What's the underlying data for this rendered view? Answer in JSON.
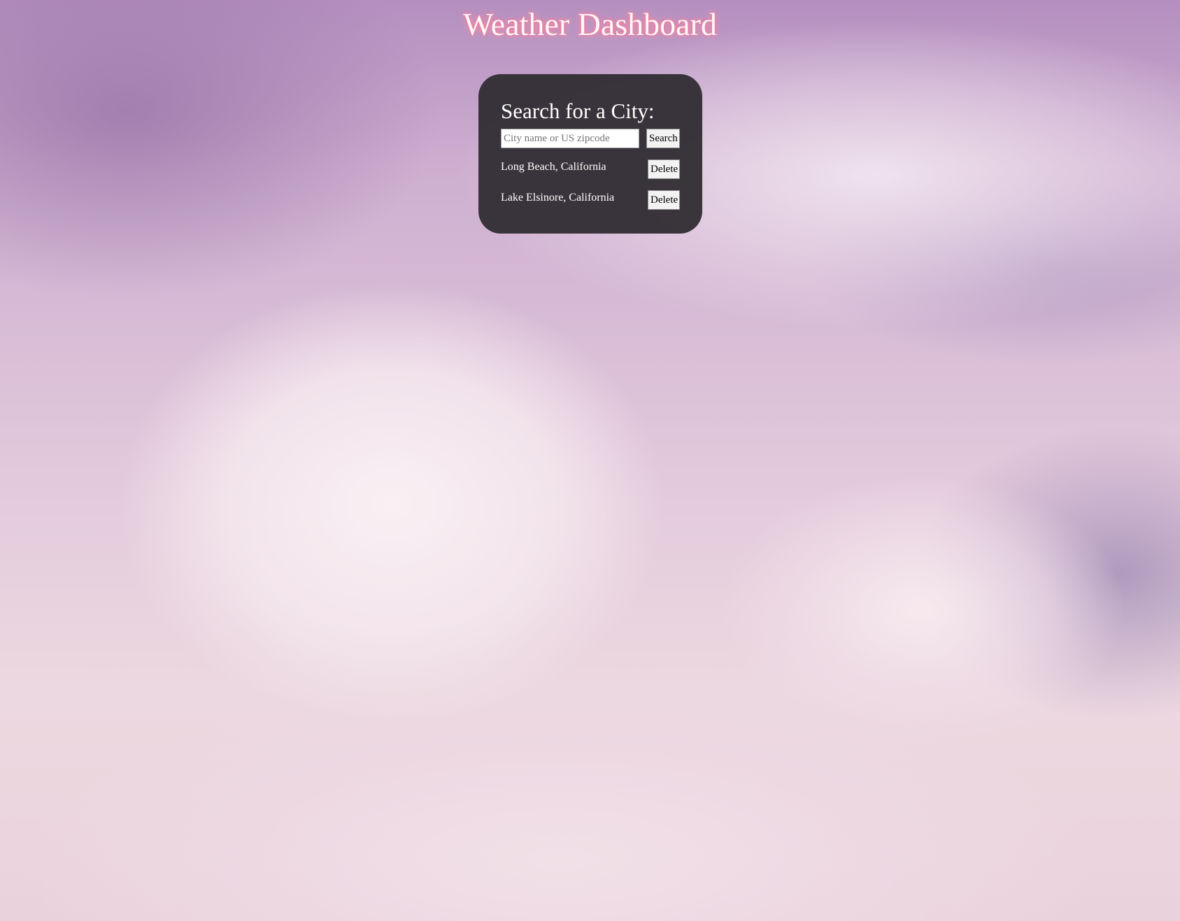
{
  "header": {
    "title": "Weather Dashboard"
  },
  "search_panel": {
    "heading": "Search for a City:",
    "input_placeholder": "City name or US zipcode",
    "input_value": "",
    "search_label": "Search",
    "saved_cities": [
      {
        "name": "Long Beach, California",
        "delete_label": "Delete"
      },
      {
        "name": "Lake Elsinore, California",
        "delete_label": "Delete"
      }
    ]
  },
  "colors": {
    "panel_bg": "#343036",
    "title_glow": "#f27a9a"
  }
}
